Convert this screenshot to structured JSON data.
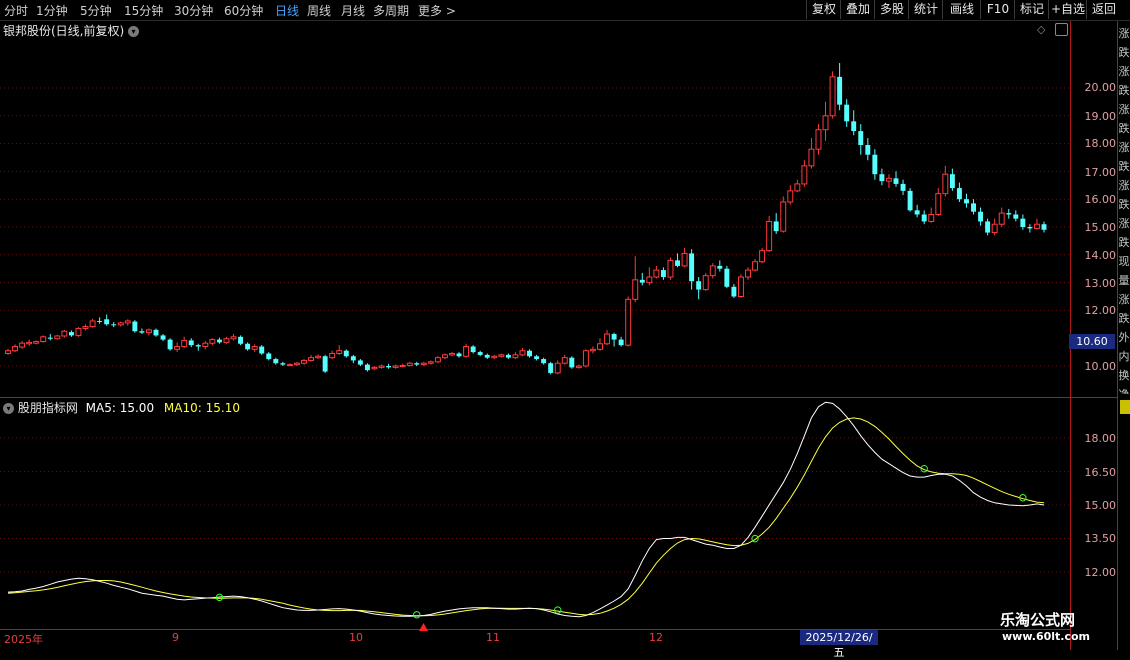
{
  "toolbar": {
    "periods": [
      "分时",
      "1分钟",
      "5分钟",
      "15分钟",
      "30分钟",
      "60分钟",
      "日线",
      "周线",
      "月线",
      "多周期",
      "更多 >"
    ],
    "active_period": "日线",
    "right_buttons": [
      "复权",
      "叠加",
      "多股",
      "统计",
      "画线",
      "F10",
      "标记",
      "+自选",
      "返回"
    ]
  },
  "main_pane": {
    "title": "银邦股份(日线,前复权)",
    "y_ticks": [
      "20.00",
      "19.00",
      "18.00",
      "17.00",
      "16.00",
      "15.00",
      "14.00",
      "13.00",
      "12.00",
      "10.00"
    ],
    "current_price": "10.60"
  },
  "indicator_pane": {
    "name": "股朋指标网",
    "ma5_label": "MA5: 15.00",
    "ma10_label": "MA10: 15.10",
    "y_ticks": [
      "18.00",
      "16.50",
      "15.00",
      "13.50",
      "12.00"
    ]
  },
  "x_axis": {
    "labels": [
      "2025年",
      "9",
      "10",
      "11",
      "12"
    ],
    "cursor_date": "2025/12/26/五"
  },
  "side_text": {
    "column_chars": "涨跌涨跌涨跌涨跌涨跌涨跌现量涨跌外内换净收"
  },
  "watermark": {
    "line1": "乐淘公式网",
    "line2": "www.60lt.com"
  },
  "colors": {
    "up": "#ff3b3b",
    "down": "#54ffff",
    "ma5": "#ffffff",
    "ma10": "#ffff40",
    "grid": "#6a1010"
  },
  "chart_data": {
    "type": "candlestick",
    "candles": [
      [
        10.45,
        10.55,
        10.62,
        10.4
      ],
      [
        10.55,
        10.7,
        10.78,
        10.5
      ],
      [
        10.68,
        10.82,
        10.9,
        10.62
      ],
      [
        10.8,
        10.85,
        10.95,
        10.72
      ],
      [
        10.82,
        10.88,
        10.92,
        10.78
      ],
      [
        10.88,
        11.05,
        11.1,
        10.84
      ],
      [
        11.02,
        10.98,
        11.15,
        10.92
      ],
      [
        10.98,
        11.08,
        11.12,
        10.95
      ],
      [
        11.08,
        11.25,
        11.3,
        11.02
      ],
      [
        11.22,
        11.1,
        11.28,
        11.05
      ],
      [
        11.1,
        11.35,
        11.4,
        11.05
      ],
      [
        11.35,
        11.42,
        11.5,
        11.28
      ],
      [
        11.42,
        11.62,
        11.7,
        11.38
      ],
      [
        11.62,
        11.6,
        11.75,
        11.52
      ],
      [
        11.68,
        11.5,
        11.85,
        11.45
      ],
      [
        11.5,
        11.48,
        11.58,
        11.4
      ],
      [
        11.48,
        11.55,
        11.6,
        11.42
      ],
      [
        11.55,
        11.62,
        11.68,
        11.45
      ],
      [
        11.6,
        11.25,
        11.65,
        11.2
      ],
      [
        11.25,
        11.2,
        11.35,
        11.15
      ],
      [
        11.2,
        11.3,
        11.35,
        11.1
      ],
      [
        11.3,
        11.1,
        11.35,
        11.05
      ],
      [
        11.1,
        10.95,
        11.15,
        10.9
      ],
      [
        10.95,
        10.6,
        11.0,
        10.55
      ],
      [
        10.6,
        10.7,
        10.85,
        10.5
      ],
      [
        10.7,
        10.92,
        11.05,
        10.65
      ],
      [
        10.92,
        10.75,
        11.0,
        10.68
      ],
      [
        10.75,
        10.7,
        10.8,
        10.55
      ],
      [
        10.7,
        10.82,
        10.9,
        10.6
      ],
      [
        10.82,
        10.95,
        11.0,
        10.75
      ],
      [
        10.95,
        10.85,
        11.02,
        10.8
      ],
      [
        10.85,
        10.98,
        11.05,
        10.8
      ],
      [
        10.98,
        11.05,
        11.15,
        10.92
      ],
      [
        11.05,
        10.8,
        11.1,
        10.75
      ],
      [
        10.8,
        10.6,
        10.85,
        10.55
      ],
      [
        10.6,
        10.7,
        10.78,
        10.5
      ],
      [
        10.7,
        10.45,
        10.75,
        10.4
      ],
      [
        10.45,
        10.25,
        10.5,
        10.2
      ],
      [
        10.25,
        10.1,
        10.3,
        10.05
      ],
      [
        10.1,
        10.05,
        10.15,
        10.0
      ],
      [
        10.05,
        10.05,
        10.1,
        10.0
      ],
      [
        10.05,
        10.1,
        10.15,
        10.0
      ],
      [
        10.1,
        10.2,
        10.25,
        10.05
      ],
      [
        10.2,
        10.3,
        10.4,
        10.15
      ],
      [
        10.3,
        10.35,
        10.42,
        10.25
      ],
      [
        10.35,
        9.8,
        10.4,
        9.75
      ],
      [
        10.3,
        10.45,
        10.55,
        10.25
      ],
      [
        10.45,
        10.55,
        10.75,
        10.4
      ],
      [
        10.55,
        10.35,
        10.6,
        10.3
      ],
      [
        10.35,
        10.2,
        10.4,
        10.1
      ],
      [
        10.2,
        10.05,
        10.25,
        10.0
      ],
      [
        10.05,
        9.85,
        10.1,
        9.8
      ],
      [
        9.9,
        9.95,
        10.0,
        9.85
      ],
      [
        9.95,
        10.0,
        10.05,
        9.9
      ],
      [
        10.0,
        9.95,
        10.08,
        9.9
      ],
      [
        9.95,
        10.0,
        10.05,
        9.9
      ],
      [
        10.0,
        10.02,
        10.08,
        9.95
      ],
      [
        10.02,
        10.1,
        10.15,
        9.98
      ],
      [
        10.1,
        10.05,
        10.15,
        10.0
      ],
      [
        10.05,
        10.1,
        10.15,
        10.0
      ],
      [
        10.1,
        10.15,
        10.2,
        10.05
      ],
      [
        10.15,
        10.3,
        10.35,
        10.1
      ],
      [
        10.3,
        10.4,
        10.45,
        10.25
      ],
      [
        10.4,
        10.45,
        10.5,
        10.35
      ],
      [
        10.45,
        10.35,
        10.5,
        10.3
      ],
      [
        10.35,
        10.7,
        10.8,
        10.3
      ],
      [
        10.7,
        10.5,
        10.75,
        10.45
      ],
      [
        10.5,
        10.4,
        10.55,
        10.35
      ],
      [
        10.4,
        10.3,
        10.45,
        10.25
      ],
      [
        10.3,
        10.35,
        10.4,
        10.25
      ],
      [
        10.35,
        10.4,
        10.45,
        10.3
      ],
      [
        10.4,
        10.3,
        10.45,
        10.25
      ],
      [
        10.3,
        10.4,
        10.5,
        10.25
      ],
      [
        10.4,
        10.55,
        10.65,
        10.35
      ],
      [
        10.55,
        10.35,
        10.6,
        10.3
      ],
      [
        10.35,
        10.25,
        10.4,
        10.2
      ],
      [
        10.25,
        10.1,
        10.3,
        10.05
      ],
      [
        10.1,
        9.75,
        10.15,
        9.7
      ],
      [
        9.75,
        10.1,
        10.2,
        9.7
      ],
      [
        10.1,
        10.3,
        10.4,
        10.05
      ],
      [
        10.3,
        9.95,
        10.35,
        9.9
      ],
      [
        9.95,
        10.0,
        10.05,
        9.9
      ],
      [
        10.0,
        10.55,
        10.6,
        9.95
      ],
      [
        10.55,
        10.6,
        10.7,
        10.45
      ],
      [
        10.6,
        10.8,
        11.0,
        10.55
      ],
      [
        10.8,
        11.15,
        11.3,
        10.75
      ],
      [
        11.15,
        10.95,
        11.2,
        10.7
      ],
      [
        10.95,
        10.75,
        11.05,
        10.7
      ],
      [
        10.75,
        12.4,
        12.5,
        10.7
      ],
      [
        12.4,
        13.1,
        13.95,
        12.3
      ],
      [
        13.1,
        13.0,
        13.35,
        12.9
      ],
      [
        13.0,
        13.2,
        13.55,
        12.9
      ],
      [
        13.2,
        13.45,
        13.6,
        13.15
      ],
      [
        13.45,
        13.2,
        13.55,
        13.1
      ],
      [
        13.2,
        13.8,
        13.9,
        13.1
      ],
      [
        13.8,
        13.6,
        14.05,
        13.55
      ],
      [
        13.6,
        14.05,
        14.25,
        13.55
      ],
      [
        14.05,
        13.05,
        14.2,
        12.75
      ],
      [
        13.05,
        12.75,
        13.2,
        12.4
      ],
      [
        12.75,
        13.25,
        13.35,
        12.7
      ],
      [
        13.25,
        13.6,
        13.7,
        13.15
      ],
      [
        13.6,
        13.5,
        13.8,
        13.4
      ],
      [
        13.5,
        12.85,
        13.6,
        12.8
      ],
      [
        12.85,
        12.5,
        12.95,
        12.45
      ],
      [
        12.5,
        13.2,
        13.3,
        12.45
      ],
      [
        13.2,
        13.45,
        13.55,
        13.1
      ],
      [
        13.45,
        13.75,
        13.85,
        13.4
      ],
      [
        13.75,
        14.15,
        14.25,
        13.7
      ],
      [
        14.15,
        15.2,
        15.4,
        14.1
      ],
      [
        15.2,
        14.85,
        15.5,
        14.75
      ],
      [
        14.85,
        15.9,
        16.1,
        14.8
      ],
      [
        15.9,
        16.3,
        16.5,
        15.8
      ],
      [
        16.3,
        16.55,
        16.7,
        16.25
      ],
      [
        16.55,
        17.2,
        17.4,
        16.45
      ],
      [
        17.2,
        17.8,
        18.2,
        17.1
      ],
      [
        17.8,
        18.5,
        18.7,
        17.6
      ],
      [
        18.5,
        19.0,
        19.5,
        18.1
      ],
      [
        19.0,
        20.4,
        20.6,
        18.9
      ],
      [
        20.4,
        19.4,
        20.9,
        19.2
      ],
      [
        19.4,
        18.8,
        19.6,
        18.6
      ],
      [
        18.8,
        18.45,
        19.2,
        18.3
      ],
      [
        18.45,
        17.95,
        18.7,
        17.6
      ],
      [
        17.95,
        17.6,
        18.2,
        17.4
      ],
      [
        17.6,
        16.9,
        17.8,
        16.7
      ],
      [
        16.9,
        16.65,
        17.1,
        16.5
      ],
      [
        16.65,
        16.75,
        16.9,
        16.4
      ],
      [
        16.75,
        16.55,
        17.0,
        16.45
      ],
      [
        16.55,
        16.3,
        16.7,
        16.15
      ],
      [
        16.3,
        15.6,
        16.4,
        15.55
      ],
      [
        15.6,
        15.45,
        15.8,
        15.35
      ],
      [
        15.45,
        15.2,
        15.6,
        15.1
      ],
      [
        15.2,
        15.45,
        15.7,
        15.15
      ],
      [
        15.45,
        16.2,
        16.4,
        15.4
      ],
      [
        16.2,
        16.9,
        17.2,
        16.1
      ],
      [
        16.9,
        16.4,
        17.1,
        16.3
      ],
      [
        16.4,
        16.0,
        16.6,
        15.9
      ],
      [
        16.0,
        15.85,
        16.2,
        15.7
      ],
      [
        15.85,
        15.55,
        16.0,
        15.45
      ],
      [
        15.55,
        15.2,
        15.7,
        15.05
      ],
      [
        15.2,
        14.8,
        15.3,
        14.7
      ],
      [
        14.8,
        15.1,
        15.3,
        14.7
      ],
      [
        15.1,
        15.5,
        15.7,
        15.0
      ],
      [
        15.5,
        15.45,
        15.65,
        15.3
      ],
      [
        15.45,
        15.3,
        15.6,
        15.2
      ],
      [
        15.3,
        15.0,
        15.45,
        14.9
      ],
      [
        15.0,
        14.95,
        15.1,
        14.8
      ],
      [
        14.95,
        15.1,
        15.3,
        14.9
      ],
      [
        15.1,
        14.9,
        15.2,
        14.8
      ]
    ],
    "price_range": [
      9.5,
      21.0
    ],
    "ma5": [
      11.1,
      11.12,
      11.15,
      11.22,
      11.28,
      11.35,
      11.45,
      11.55,
      11.62,
      11.68,
      11.72,
      11.7,
      11.65,
      11.58,
      11.5,
      11.4,
      11.32,
      11.25,
      11.15,
      11.05,
      11.0,
      10.96,
      10.92,
      10.85,
      10.78,
      10.75,
      10.78,
      10.8,
      10.83,
      10.85,
      10.88,
      10.9,
      10.92,
      10.9,
      10.85,
      10.78,
      10.7,
      10.6,
      10.5,
      10.4,
      10.35,
      10.3,
      10.28,
      10.28,
      10.3,
      10.32,
      10.35,
      10.36,
      10.34,
      10.3,
      10.25,
      10.18,
      10.12,
      10.08,
      10.05,
      10.03,
      10.02,
      10.02,
      10.03,
      10.05,
      10.1,
      10.18,
      10.25,
      10.3,
      10.35,
      10.38,
      10.4,
      10.4,
      10.4,
      10.38,
      10.36,
      10.34,
      10.34,
      10.36,
      10.38,
      10.36,
      10.3,
      10.22,
      10.12,
      10.05,
      10.02,
      10.0,
      10.05,
      10.18,
      10.35,
      10.52,
      10.7,
      10.9,
      11.25,
      11.85,
      12.5,
      13.05,
      13.45,
      13.5,
      13.5,
      13.55,
      13.55,
      13.45,
      13.35,
      13.25,
      13.2,
      13.12,
      13.05,
      13.05,
      13.2,
      13.55,
      14.0,
      14.5,
      15.0,
      15.5,
      16.0,
      16.6,
      17.3,
      18.1,
      18.9,
      19.4,
      19.6,
      19.55,
      19.3,
      18.95,
      18.55,
      18.1,
      17.7,
      17.35,
      17.05,
      16.85,
      16.65,
      16.45,
      16.3,
      16.25,
      16.25,
      16.32,
      16.38,
      16.38,
      16.3,
      16.1,
      15.85,
      15.55,
      15.35,
      15.2,
      15.1,
      15.05,
      15.0,
      14.98,
      14.97,
      15.0,
      15.05,
      15.0
    ],
    "ma10": [
      11.05,
      11.07,
      11.1,
      11.13,
      11.16,
      11.2,
      11.25,
      11.31,
      11.38,
      11.45,
      11.52,
      11.57,
      11.6,
      11.62,
      11.62,
      11.6,
      11.55,
      11.48,
      11.4,
      11.32,
      11.23,
      11.15,
      11.08,
      11.02,
      10.97,
      10.92,
      10.88,
      10.86,
      10.84,
      10.83,
      10.82,
      10.83,
      10.84,
      10.84,
      10.84,
      10.82,
      10.78,
      10.72,
      10.66,
      10.6,
      10.52,
      10.45,
      10.39,
      10.34,
      10.3,
      10.28,
      10.27,
      10.27,
      10.28,
      10.28,
      10.28,
      10.25,
      10.22,
      10.18,
      10.14,
      10.1,
      10.07,
      10.05,
      10.04,
      10.04,
      10.05,
      10.08,
      10.12,
      10.17,
      10.22,
      10.27,
      10.31,
      10.35,
      10.37,
      10.38,
      10.38,
      10.37,
      10.37,
      10.37,
      10.37,
      10.36,
      10.34,
      10.3,
      10.25,
      10.2,
      10.15,
      10.1,
      10.08,
      10.1,
      10.15,
      10.25,
      10.38,
      10.55,
      10.78,
      11.1,
      11.5,
      11.95,
      12.4,
      12.75,
      13.05,
      13.3,
      13.45,
      13.5,
      13.48,
      13.42,
      13.35,
      13.28,
      13.22,
      13.18,
      13.2,
      13.28,
      13.45,
      13.7,
      14.0,
      14.4,
      14.85,
      15.3,
      15.8,
      16.35,
      16.95,
      17.55,
      18.05,
      18.45,
      18.7,
      18.85,
      18.9,
      18.85,
      18.72,
      18.52,
      18.25,
      17.95,
      17.62,
      17.3,
      17.0,
      16.75,
      16.58,
      16.48,
      16.42,
      16.4,
      16.4,
      16.38,
      16.32,
      16.2,
      16.05,
      15.9,
      15.75,
      15.6,
      15.48,
      15.38,
      15.28,
      15.2,
      15.13,
      15.1
    ],
    "ind_range": [
      10.6,
      19.6
    ],
    "markers": [
      {
        "series": "ma10",
        "index": 30,
        "symbol": "S"
      },
      {
        "series": "ma10",
        "index": 58,
        "symbol": "S"
      },
      {
        "series": "ma10",
        "index": 78,
        "symbol": "S"
      },
      {
        "series": "ma10",
        "index": 106,
        "symbol": "S"
      },
      {
        "series": "ma10",
        "index": 130,
        "symbol": "S"
      },
      {
        "series": "ma10",
        "index": 144,
        "symbol": "S"
      }
    ]
  }
}
